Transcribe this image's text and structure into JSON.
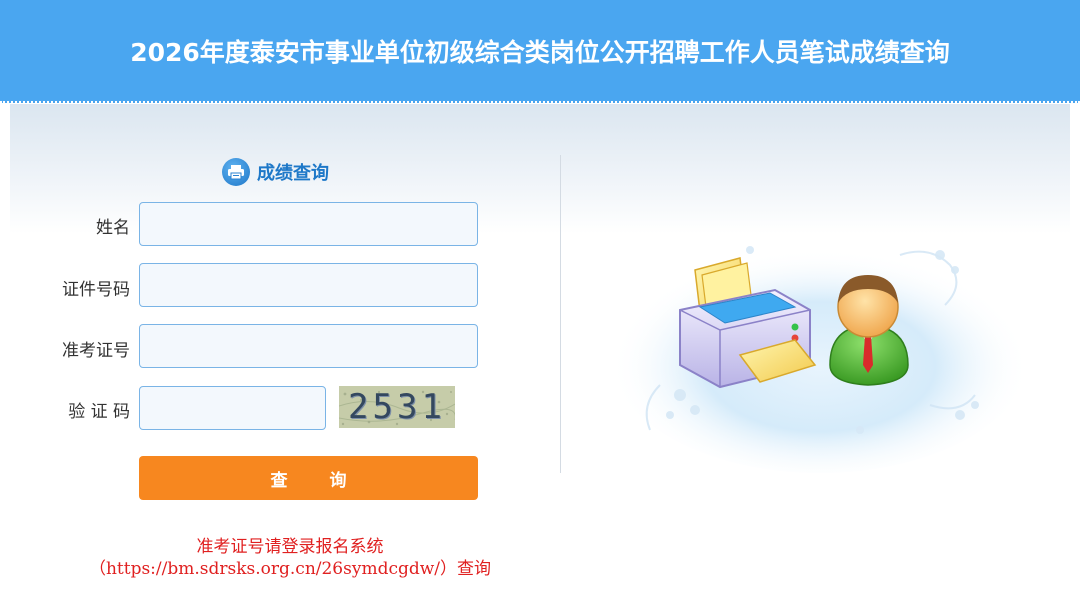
{
  "header": {
    "title": "2026年度泰安市事业单位初级综合类岗位公开招聘工作人员笔试成绩查询"
  },
  "form": {
    "title": "成绩查询",
    "name_label": "姓名",
    "id_label": "证件号码",
    "ticket_label": "准考证号",
    "captcha_label": "验 证 码",
    "captcha_code": "2531",
    "submit_label": "查 询"
  },
  "note": {
    "line1": "准考证号请登录报名系统",
    "line2": "（https://bm.sdrsks.org.cn/26symdcgdw/）查询"
  },
  "colors": {
    "header_bg": "#4aa6f0",
    "accent": "#1e78c8",
    "button": "#f7871f",
    "note": "#e02020"
  },
  "icons": {
    "form_title": "printer-icon",
    "illustration": "printer-user-illustration"
  }
}
